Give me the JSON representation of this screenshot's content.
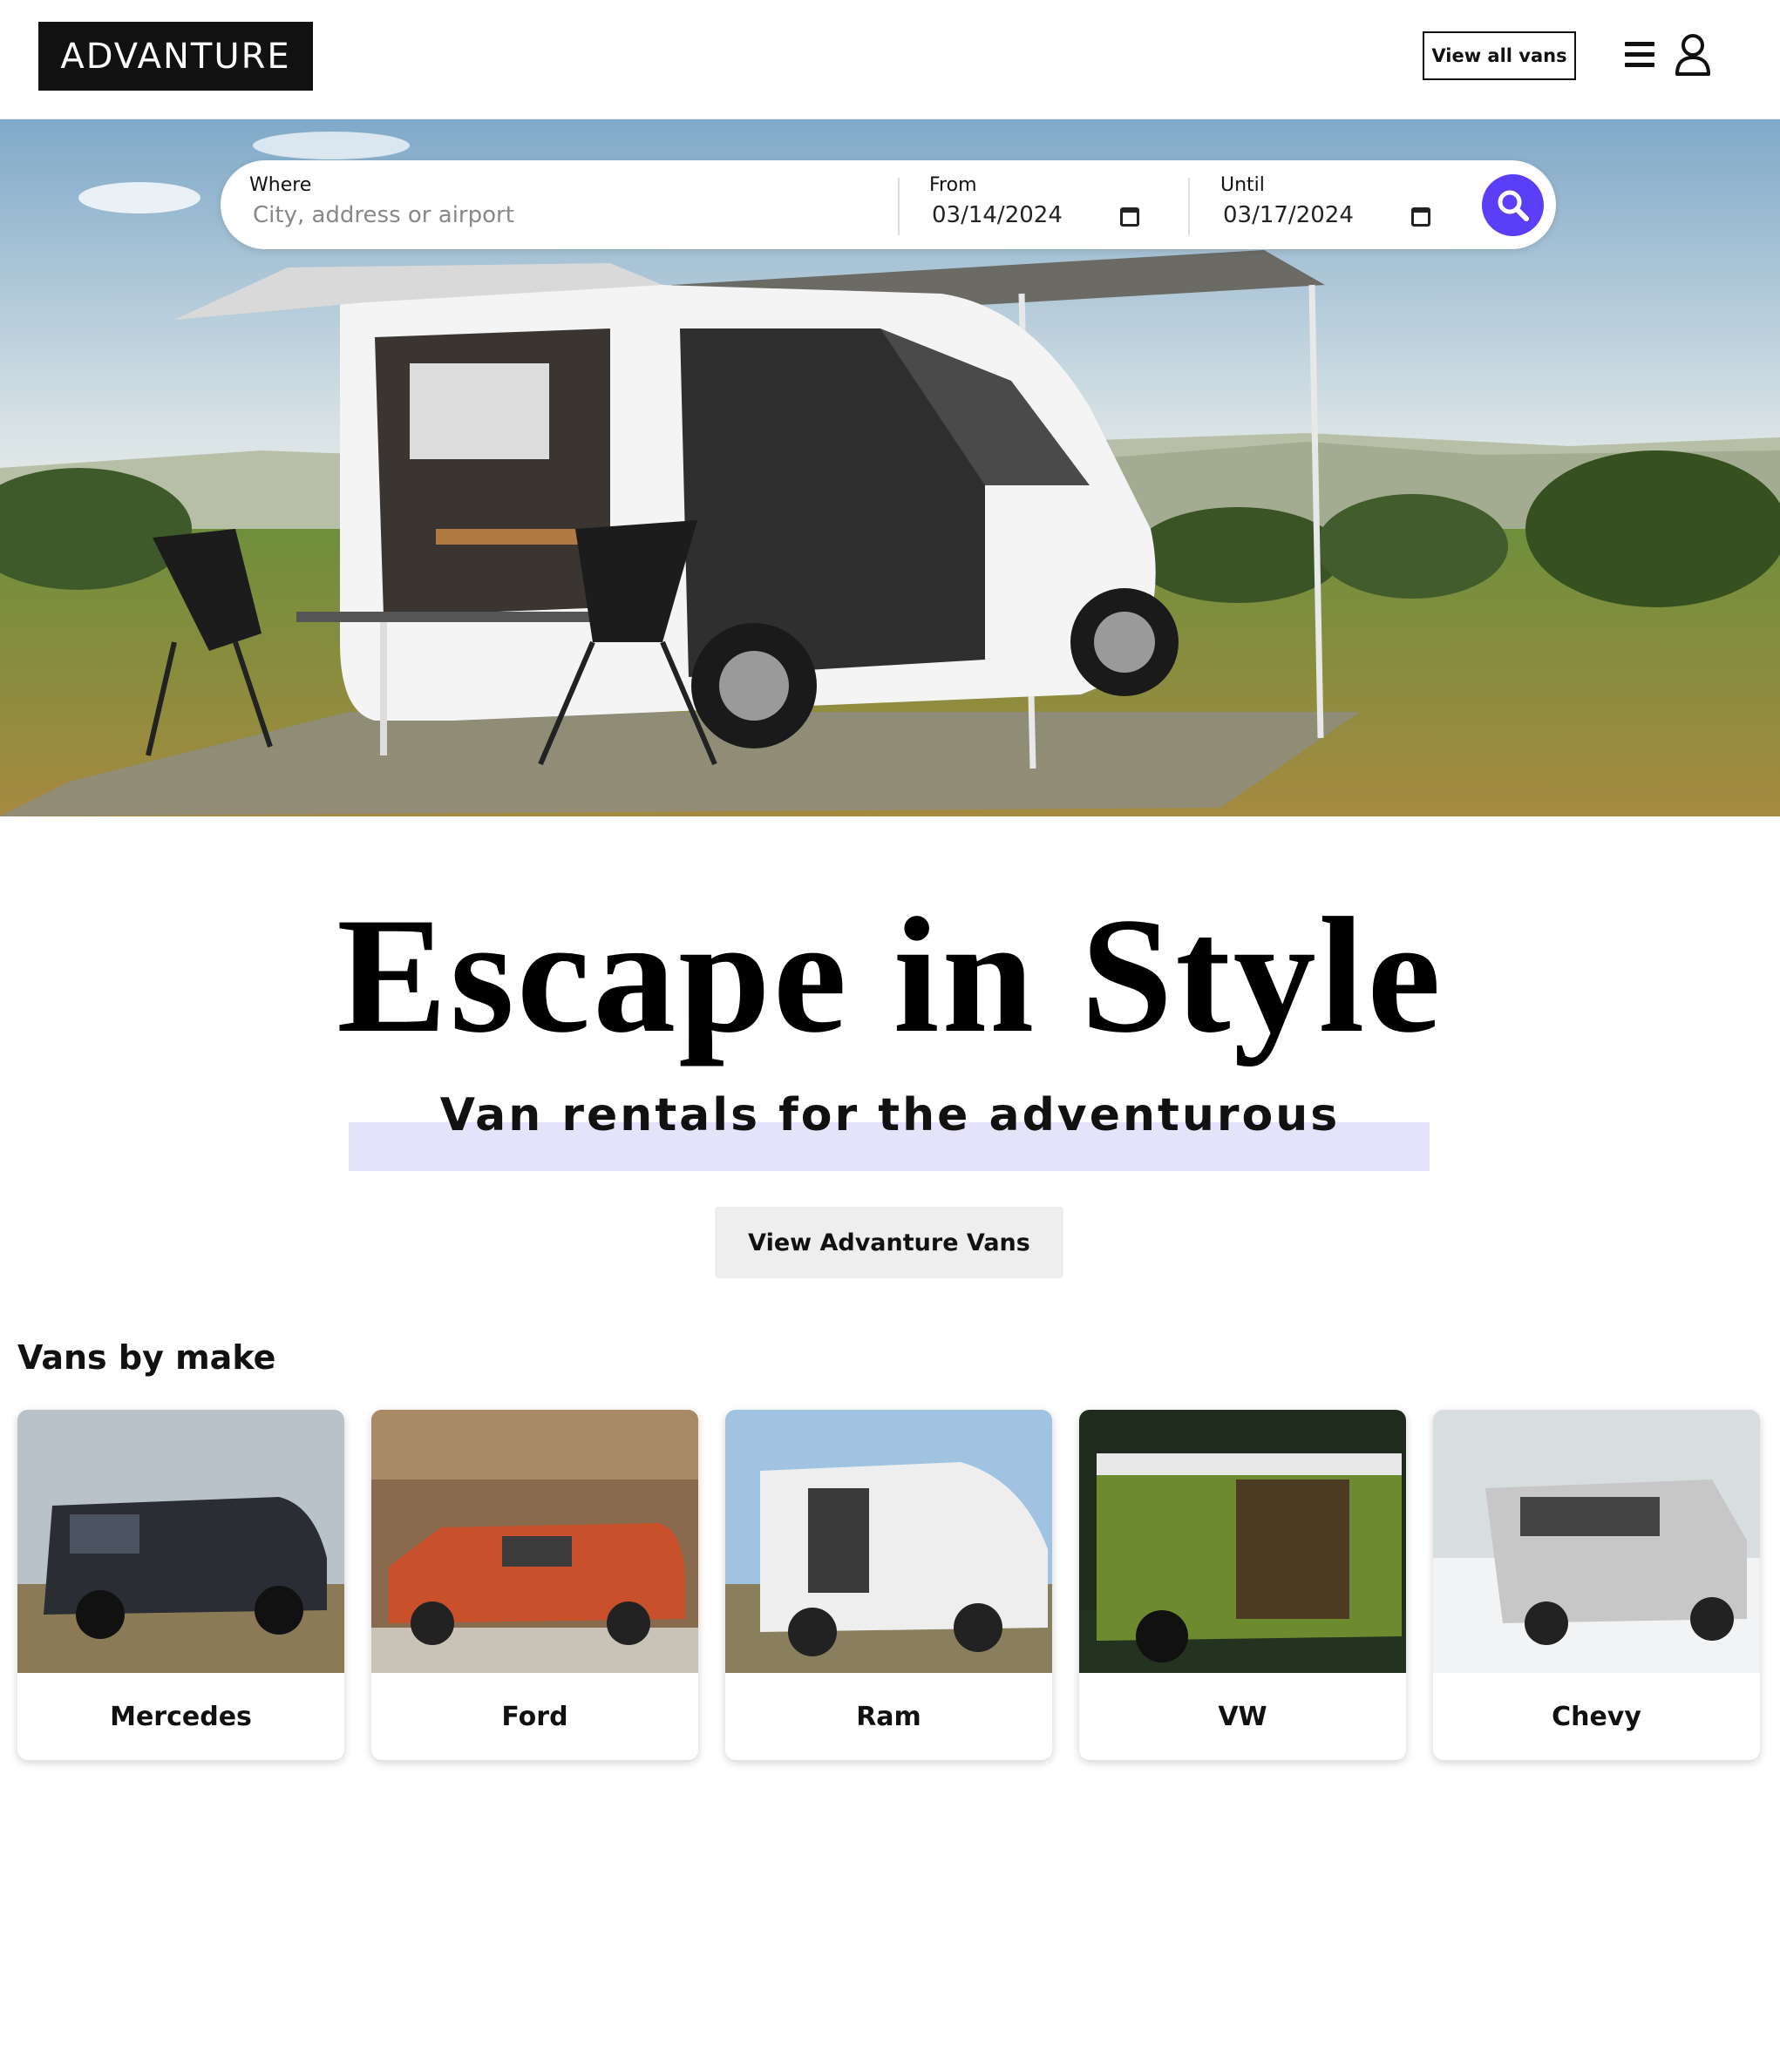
{
  "header": {
    "logo": "ADVANTURE",
    "view_all_label": "View all vans",
    "icons": [
      "menu-icon",
      "user-icon"
    ]
  },
  "search": {
    "where_label": "Where",
    "where_placeholder": "City, address or airport",
    "from_label": "From",
    "from_value": "03/14/2024",
    "until_label": "Until",
    "until_value": "03/17/2024",
    "search_icon": "search-icon",
    "accent_color": "#5b3ff6"
  },
  "hero": {
    "title": "Escape in Style",
    "subtitle": "Van rentals for the adventurous",
    "cta_label": "View Advanture Vans",
    "highlight_color": "#e5e3fc"
  },
  "makes": {
    "heading": "Vans by make",
    "items": [
      {
        "label": "Mercedes"
      },
      {
        "label": "Ford"
      },
      {
        "label": "Ram"
      },
      {
        "label": "VW"
      },
      {
        "label": "Chevy"
      }
    ]
  }
}
